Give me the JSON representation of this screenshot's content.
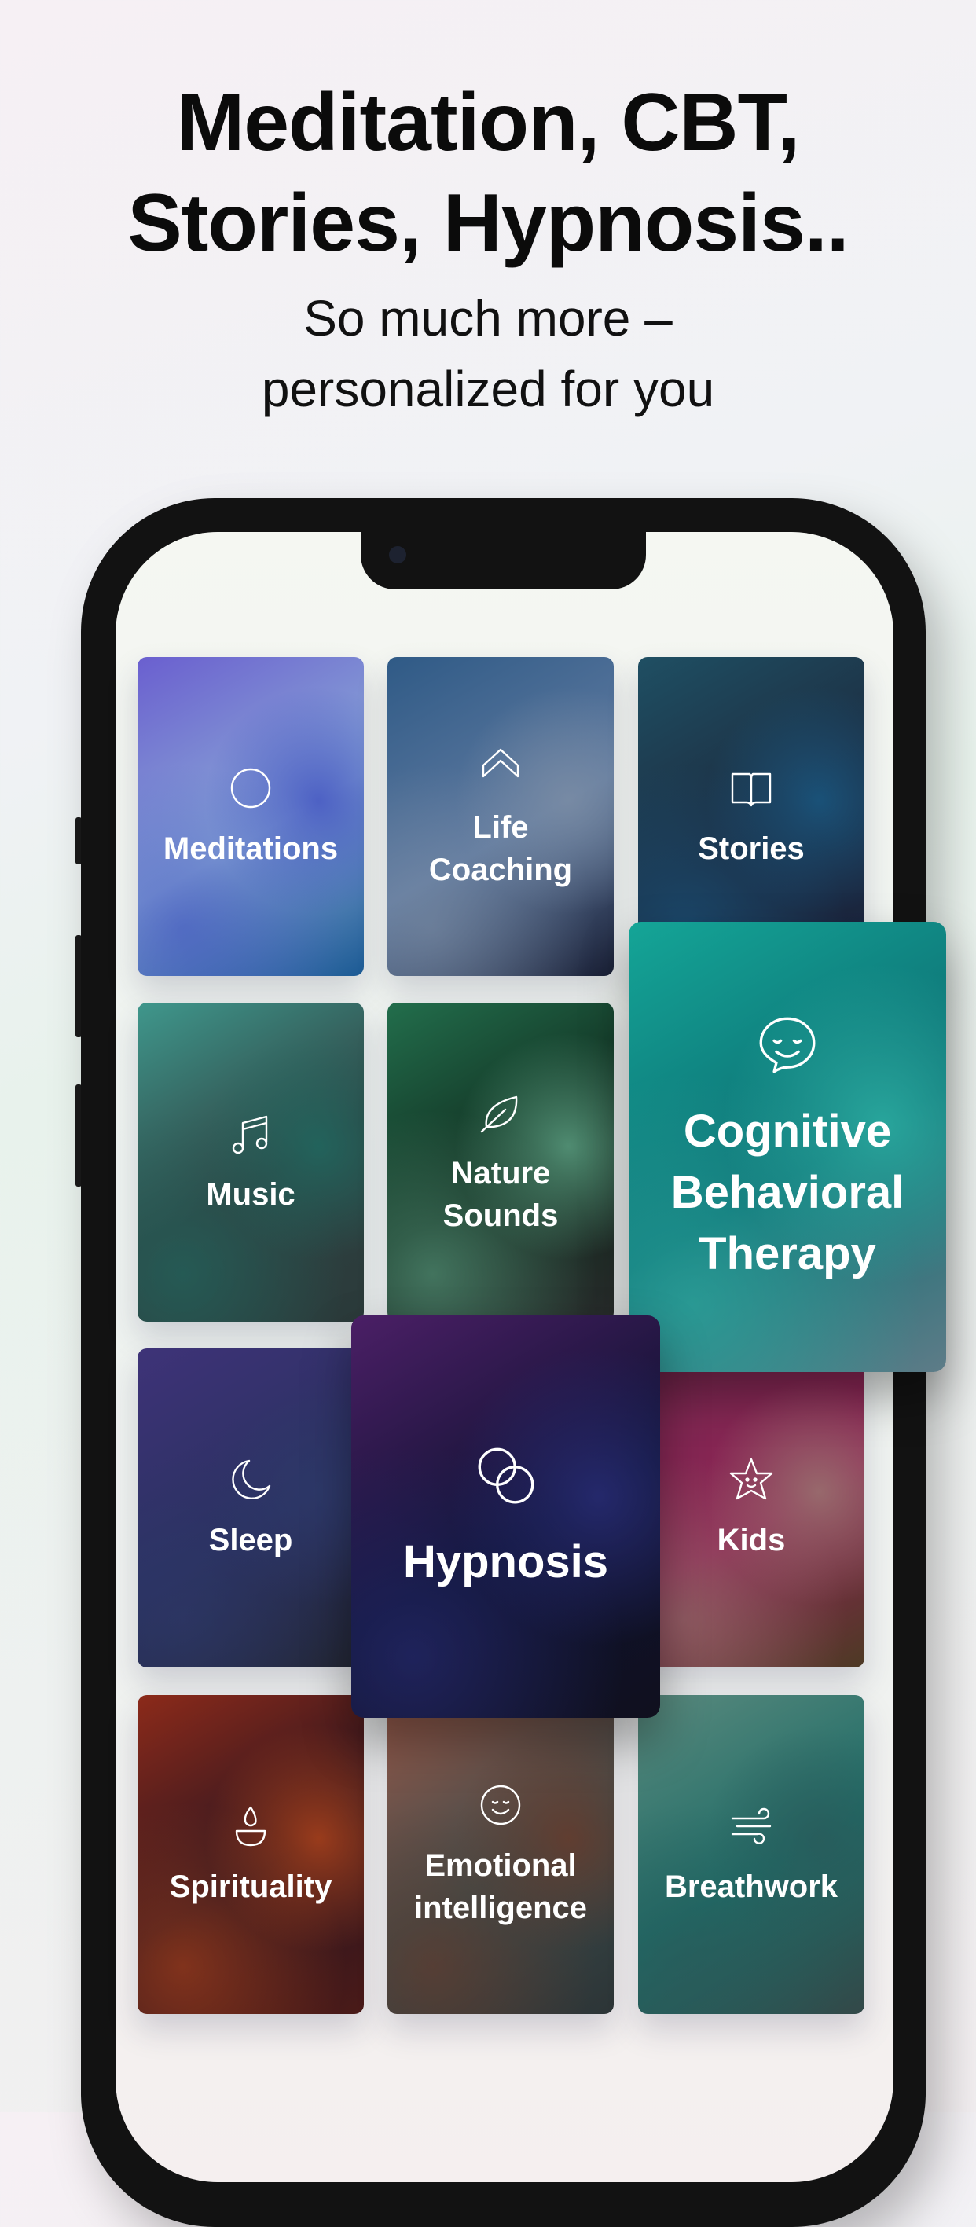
{
  "headline": {
    "line1": "Meditation, CBT,",
    "line2": "Stories, Hypnosis.."
  },
  "subheadline": {
    "line1": "So much more –",
    "line2": "personalized for you"
  },
  "categories": [
    {
      "label": "Meditations",
      "icon": "circle-icon",
      "colors": [
        "#6a5fcf",
        "#8aa9d6",
        "#3e4fc0",
        "#1b5a94"
      ]
    },
    {
      "label": "Life\nCoaching",
      "icon": "chevron-up-icon",
      "colors": [
        "#2f5a86",
        "#5f7aa0",
        "#7d8ea5",
        "#1a2036"
      ]
    },
    {
      "label": "Stories",
      "icon": "book-icon",
      "colors": [
        "#1f4f63",
        "#1c2a3e",
        "#1a5b86",
        "#1a2540"
      ]
    },
    {
      "label": "Music",
      "icon": "music-note-icon",
      "colors": [
        "#3f978c",
        "#2f4242",
        "#1f6b62",
        "#2b3a3a"
      ]
    },
    {
      "label": "Nature\nSounds",
      "icon": "leaf-icon",
      "colors": [
        "#226e4c",
        "#10291d",
        "#5fa486",
        "#2a2d2d"
      ]
    },
    {
      "label": "Cognitive\nBehavioral\nTherapy",
      "icon": "chat-smile-icon",
      "featured": true,
      "colors": [
        "#14a597",
        "#0d6d72",
        "#2fb3a6",
        "#5e7c88"
      ]
    },
    {
      "label": "Sleep",
      "icon": "moon-icon",
      "colors": [
        "#3e3378",
        "#2a3060",
        "#2e3a6a",
        "#222633"
      ]
    },
    {
      "label": "Hypnosis",
      "icon": "rings-icon",
      "featured": true,
      "colors": [
        "#4b1f66",
        "#0e1230",
        "#2a2e7a",
        "#10101e"
      ]
    },
    {
      "label": "Kids",
      "icon": "star-icon",
      "colors": [
        "#7a2a52",
        "#8e2354",
        "#9a7a72",
        "#4d3a24"
      ]
    },
    {
      "label": "Spirituality",
      "icon": "flame-bowl-icon",
      "colors": [
        "#8c2a1a",
        "#2a1520",
        "#b5451a",
        "#4a1a18"
      ]
    },
    {
      "label": "Emotional\nintelligence",
      "icon": "smile-icon",
      "colors": [
        "#9a5a4a",
        "#3a4a4a",
        "#6a3a2a",
        "#2c3436"
      ]
    },
    {
      "label": "Breathwork",
      "icon": "wind-icon",
      "colors": [
        "#5a8a7e",
        "#1e6b66",
        "#2a5a5a",
        "#334848"
      ]
    }
  ]
}
